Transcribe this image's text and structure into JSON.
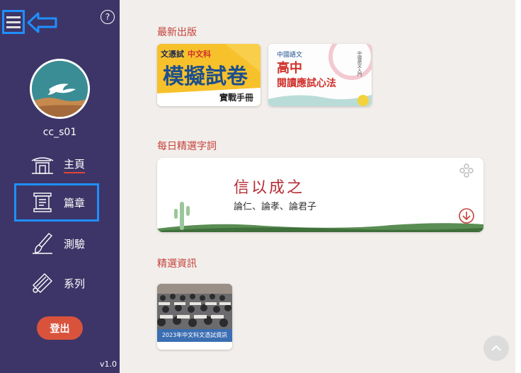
{
  "sidebar": {
    "help_label": "?",
    "username": "cc_s01",
    "nav": [
      {
        "label": "主頁",
        "icon": "temple-icon"
      },
      {
        "label": "篇章",
        "icon": "scroll-icon"
      },
      {
        "label": "測驗",
        "icon": "brush-icon"
      },
      {
        "label": "系列",
        "icon": "scrolls-icon"
      }
    ],
    "logout_label": "登出",
    "version": "v1.0"
  },
  "main": {
    "new_title": "最新出版",
    "books": [
      {
        "tag1": "文憑試",
        "tag2": "中文科",
        "title": "模擬試卷",
        "subtitle": "實戰手冊"
      },
      {
        "series": "中國語文",
        "title1": "高中",
        "title2": "閱讀應試心法",
        "side": "中國語文入門"
      }
    ],
    "daily_title": "每日精選字詞",
    "daily_phrase": "信以成之",
    "daily_sub": "論仁、論孝、論君子",
    "news_title": "精選資訊",
    "news_caption": "2023年中文科文憑試資訊"
  },
  "colors": {
    "sidebar": "#3d3567",
    "accent_red": "#c4423a",
    "highlight_blue": "#1e90ff",
    "logout": "#d9533c"
  }
}
